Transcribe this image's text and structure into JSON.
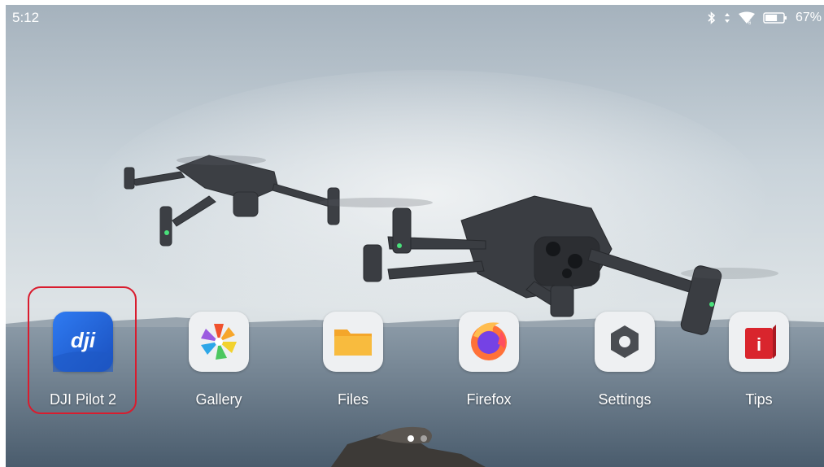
{
  "status_bar": {
    "time": "5:12",
    "battery_percent": "67%",
    "battery_level": 0.67,
    "icons": [
      "bluetooth-icon",
      "data-transfer-icon",
      "wifi-icon",
      "battery-icon"
    ]
  },
  "apps": [
    {
      "label": "DJI Pilot 2",
      "icon": "dji-pilot-icon",
      "brand_text": "dji",
      "selected": true
    },
    {
      "label": "Gallery",
      "icon": "gallery-icon"
    },
    {
      "label": "Files",
      "icon": "files-icon"
    },
    {
      "label": "Firefox",
      "icon": "firefox-icon"
    },
    {
      "label": "Settings",
      "icon": "settings-icon"
    },
    {
      "label": "Tips",
      "icon": "tips-icon",
      "brand_text": "i"
    }
  ],
  "page_indicator": {
    "current": 1,
    "total": 2
  },
  "colors": {
    "highlight": "#d91c2e",
    "dji_blue": "#1f5fd1",
    "sky_top": "#a7b4bf",
    "sea": "#5f7284"
  }
}
